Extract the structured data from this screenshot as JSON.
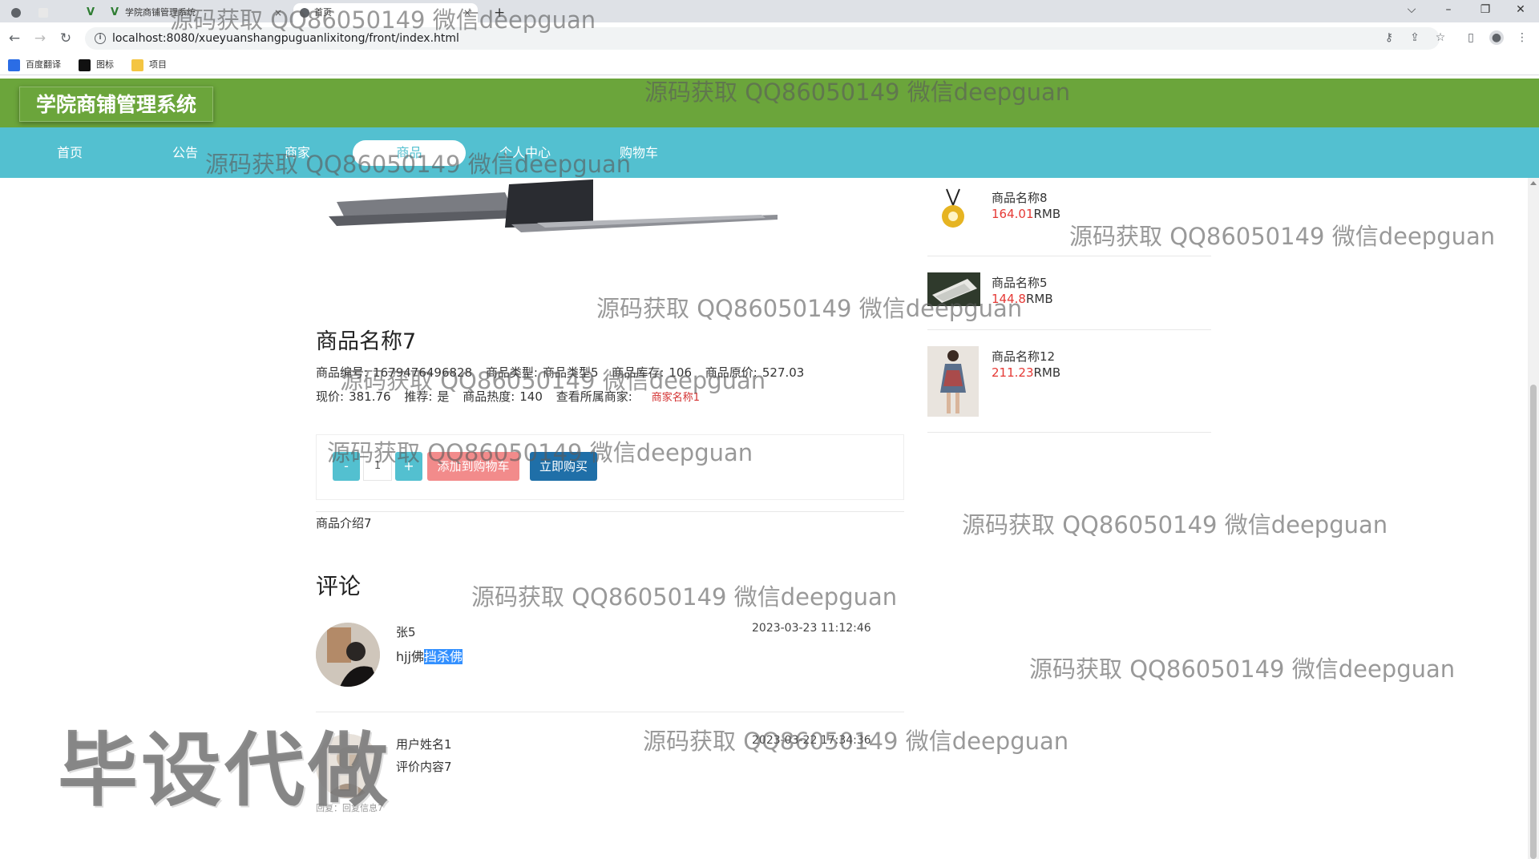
{
  "browser": {
    "tabs": [
      {
        "label": ""
      },
      {
        "label": ""
      },
      {
        "label": "学院商铺管理系统"
      },
      {
        "label": "首页"
      }
    ],
    "new_tab_label": "+",
    "url": "localhost:8080/xueyuanshangpuguanlixitong/front/index.html",
    "bookmarks": [
      {
        "label": "百度翻译",
        "color": "#2b6de5"
      },
      {
        "label": "图标",
        "color": "#111111"
      },
      {
        "label": "项目",
        "color": "#f4c542"
      }
    ]
  },
  "site": {
    "title": "学院商铺管理系统",
    "header_color": "#6ba53b",
    "nav_color": "#53c0d0",
    "nav": [
      {
        "label": "首页"
      },
      {
        "label": "公告"
      },
      {
        "label": "商家"
      },
      {
        "label": "商品"
      },
      {
        "label": "个人中心"
      },
      {
        "label": "购物车"
      }
    ]
  },
  "product": {
    "name": "商品名称7",
    "row1": [
      {
        "label": "商品编号:",
        "value": "1679476496828"
      },
      {
        "label": "商品类型:",
        "value": "商品类型5"
      },
      {
        "label": "商品库存:",
        "value": "106"
      },
      {
        "label": "商品原价:",
        "value": "527.03"
      }
    ],
    "row2": [
      {
        "label": "现价:",
        "value": "381.76"
      },
      {
        "label": "推荐:",
        "value": "是"
      },
      {
        "label": "商品热度:",
        "value": "140"
      }
    ],
    "merchant_label": "查看所属商家:",
    "merchant_link": "商家名称1",
    "quantity": "1",
    "minus_label": "-",
    "plus_label": "+",
    "add_to_cart": "添加到购物车",
    "buy_now": "立即购买",
    "intro": "商品介绍7"
  },
  "comments": {
    "title": "评论",
    "items": [
      {
        "user": "张5",
        "time": "2023-03-23 11:12:46",
        "text_plain": "hjj佛",
        "text_selected": "挡杀佛"
      },
      {
        "user": "用户姓名1",
        "time": "2023-03-22 17:34:36",
        "text_plain": "评价内容7",
        "text_selected": ""
      }
    ],
    "reply": "回复：回复信息7"
  },
  "sidebar": {
    "items": [
      {
        "name": "商品名称8",
        "price": "164.01",
        "unit": "RMB"
      },
      {
        "name": "商品名称5",
        "price": "144.8",
        "unit": "RMB"
      },
      {
        "name": "商品名称12",
        "price": "211.23",
        "unit": "RMB"
      }
    ]
  },
  "watermarks": {
    "text": "源码获取 QQ86050149 微信deepguan",
    "big": "毕设代做"
  }
}
